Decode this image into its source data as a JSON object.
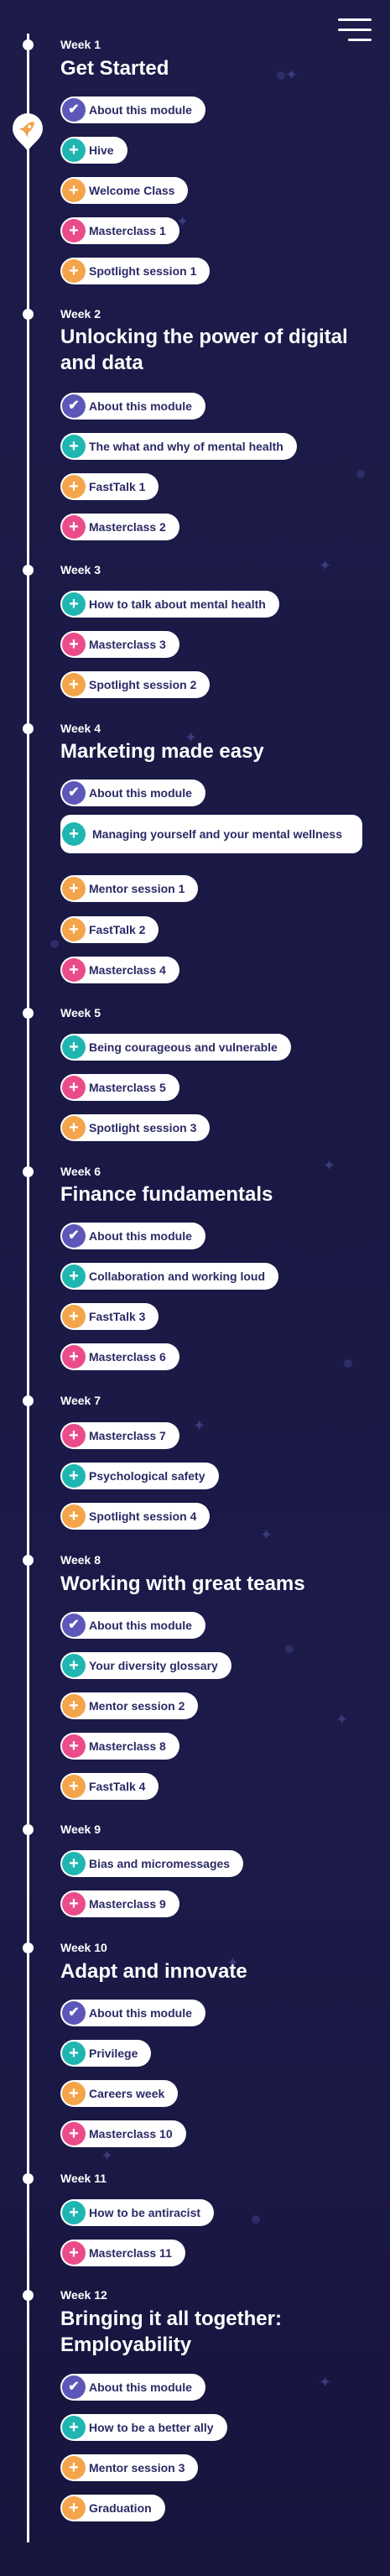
{
  "menu": {
    "icon": "hamburger-menu-icon"
  },
  "colors": {
    "background": "#1d1b4a",
    "check": "#5c57b8",
    "teal": "#1fb6b1",
    "orange": "#f4a44a",
    "pink": "#ea4c8a",
    "pill_text": "#2a2a66"
  },
  "weeks": [
    {
      "label": "Week 1",
      "title": "Get Started",
      "items": [
        {
          "icon": "check",
          "label": "About this module"
        },
        {
          "icon": "teal",
          "label": "Hive"
        },
        {
          "icon": "orange",
          "label": "Welcome Class"
        },
        {
          "icon": "pink",
          "label": "Masterclass 1"
        },
        {
          "icon": "orange",
          "label": "Spotlight session 1"
        }
      ]
    },
    {
      "label": "Week 2",
      "title": "Unlocking the power of digital and data",
      "items": [
        {
          "icon": "check",
          "label": "About this module"
        },
        {
          "icon": "teal",
          "label": "The what and why of mental health"
        },
        {
          "icon": "orange",
          "label": "FastTalk 1"
        },
        {
          "icon": "pink",
          "label": "Masterclass 2"
        }
      ]
    },
    {
      "label": "Week 3",
      "title": "",
      "items": [
        {
          "icon": "teal",
          "label": "How to talk about mental health"
        },
        {
          "icon": "pink",
          "label": "Masterclass 3"
        },
        {
          "icon": "orange",
          "label": "Spotlight session 2"
        }
      ]
    },
    {
      "label": "Week 4",
      "title": "Marketing made easy",
      "items": [
        {
          "icon": "check",
          "label": "About this module"
        },
        {
          "icon": "teal",
          "label": "Managing yourself and your mental wellness"
        },
        {
          "icon": "orange",
          "label": "Mentor session 1"
        },
        {
          "icon": "orange",
          "label": "FastTalk 2"
        },
        {
          "icon": "pink",
          "label": "Masterclass 4"
        }
      ]
    },
    {
      "label": "Week 5",
      "title": "",
      "items": [
        {
          "icon": "teal",
          "label": "Being courageous and vulnerable"
        },
        {
          "icon": "pink",
          "label": "Masterclass 5"
        },
        {
          "icon": "orange",
          "label": "Spotlight session 3"
        }
      ]
    },
    {
      "label": "Week 6",
      "title": "Finance fundamentals",
      "items": [
        {
          "icon": "check",
          "label": "About this module"
        },
        {
          "icon": "teal",
          "label": "Collaboration and working loud"
        },
        {
          "icon": "orange",
          "label": "FastTalk 3"
        },
        {
          "icon": "pink",
          "label": "Masterclass 6"
        }
      ]
    },
    {
      "label": "Week 7",
      "title": "",
      "items": [
        {
          "icon": "pink",
          "label": "Masterclass 7"
        },
        {
          "icon": "teal",
          "label": "Psychological safety"
        },
        {
          "icon": "orange",
          "label": "Spotlight session 4"
        }
      ]
    },
    {
      "label": "Week 8",
      "title": "Working with great teams",
      "items": [
        {
          "icon": "check",
          "label": "About this module"
        },
        {
          "icon": "teal",
          "label": "Your diversity glossary"
        },
        {
          "icon": "orange",
          "label": "Mentor session 2"
        },
        {
          "icon": "pink",
          "label": "Masterclass 8"
        },
        {
          "icon": "orange",
          "label": "FastTalk 4"
        }
      ]
    },
    {
      "label": "Week 9",
      "title": "",
      "items": [
        {
          "icon": "teal",
          "label": "Bias and micromessages"
        },
        {
          "icon": "pink",
          "label": "Masterclass 9"
        }
      ]
    },
    {
      "label": "Week 10",
      "title": "Adapt and innovate",
      "items": [
        {
          "icon": "check",
          "label": "About this module"
        },
        {
          "icon": "teal",
          "label": "Privilege"
        },
        {
          "icon": "orange",
          "label": "Careers week"
        },
        {
          "icon": "pink",
          "label": "Masterclass 10"
        }
      ]
    },
    {
      "label": "Week 11",
      "title": "",
      "items": [
        {
          "icon": "teal",
          "label": "How to be antiracist"
        },
        {
          "icon": "pink",
          "label": "Masterclass 11"
        }
      ]
    },
    {
      "label": "Week 12",
      "title": "Bringing it all together: Employability",
      "items": [
        {
          "icon": "check",
          "label": "About this module"
        },
        {
          "icon": "teal",
          "label": "How to be a better ally"
        },
        {
          "icon": "orange",
          "label": "Mentor session 3"
        },
        {
          "icon": "orange",
          "label": "Graduation"
        }
      ]
    }
  ]
}
